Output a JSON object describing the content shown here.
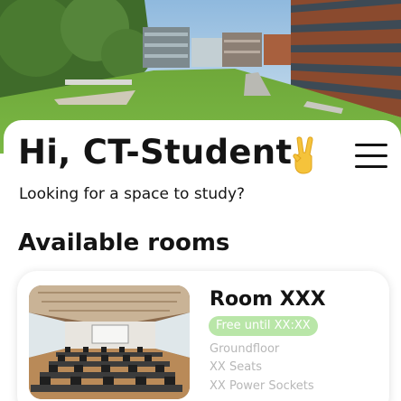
{
  "header": {
    "greeting": "Hi, CT-Student",
    "greeting_emoji_icon": "victory-hand-icon",
    "menu_icon": "hamburger-menu-icon",
    "subtitle": "Looking for a space to study?"
  },
  "rooms_section": {
    "title": "Available rooms",
    "rooms": [
      {
        "name": "Room XXX",
        "status": "Free until XX:XX",
        "floor": "Groundfloor",
        "seats": "XX Seats",
        "power": "XX Power Sockets"
      }
    ]
  },
  "colors": {
    "text": "#141414",
    "status_badge_bg": "#b9e6a8",
    "meta_text": "#b7b7b7"
  }
}
